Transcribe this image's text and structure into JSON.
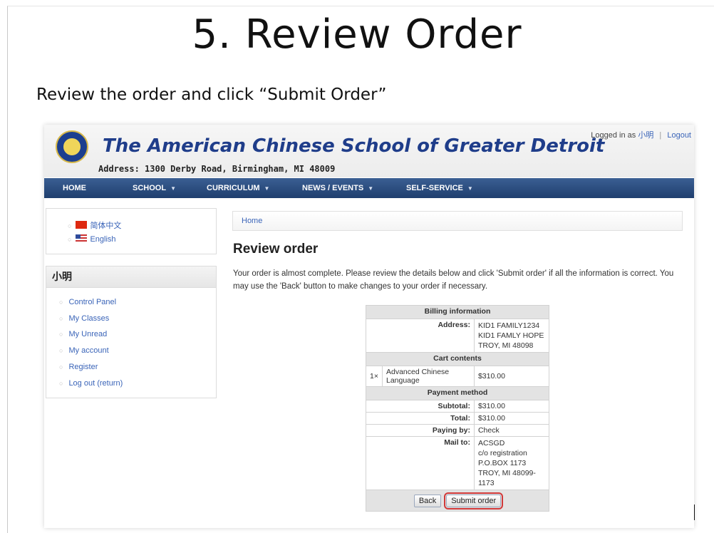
{
  "slide": {
    "title": "5. Review Order",
    "subtitle": "Review the order and click “Submit Order”"
  },
  "site": {
    "name": "The American Chinese School of Greater Detroit",
    "address": "Address: 1300 Derby Road, Birmingham, MI 48009",
    "login_prefix": "Logged in as",
    "user": "小明",
    "separator": "|",
    "logout": "Logout"
  },
  "nav": {
    "items": [
      {
        "label": "HOME"
      },
      {
        "label": "SCHOOL"
      },
      {
        "label": "CURRICULUM"
      },
      {
        "label": "NEWS / EVENTS"
      },
      {
        "label": "SELF-SERVICE"
      }
    ]
  },
  "languages": [
    {
      "label": "简体中文"
    },
    {
      "label": "English"
    }
  ],
  "user_menu": {
    "title": "小明",
    "items": [
      {
        "label": "Control Panel"
      },
      {
        "label": "My Classes"
      },
      {
        "label": "My Unread"
      },
      {
        "label": "My account"
      },
      {
        "label": "Register"
      },
      {
        "label": "Log out (return)"
      }
    ]
  },
  "breadcrumb": "Home",
  "page": {
    "title": "Review order",
    "intro": "Your order is almost complete. Please review the details below and click 'Submit order' if all the information is correct. You may use the 'Back' button to make changes to your order if necessary."
  },
  "order": {
    "billing_header": "Billing information",
    "address_label": "Address:",
    "address_lines": [
      "KID1 FAMILY1234",
      "KID1 FAMLY HOPE",
      "TROY, MI 48098"
    ],
    "cart_header": "Cart contents",
    "cart_qty": "1×",
    "cart_item": "Advanced Chinese Language",
    "cart_price": "$310.00",
    "payment_header": "Payment method",
    "subtotal_label": "Subtotal:",
    "subtotal": "$310.00",
    "total_label": "Total:",
    "total": "$310.00",
    "paying_by_label": "Paying by:",
    "paying_by": "Check",
    "mail_to_label": "Mail to:",
    "mail_to_lines": [
      "ACSGD",
      "c/o registration",
      "P.O.BOX 1173",
      "TROY, MI 48099-1173"
    ],
    "back_label": "Back",
    "submit_label": "Submit order"
  }
}
